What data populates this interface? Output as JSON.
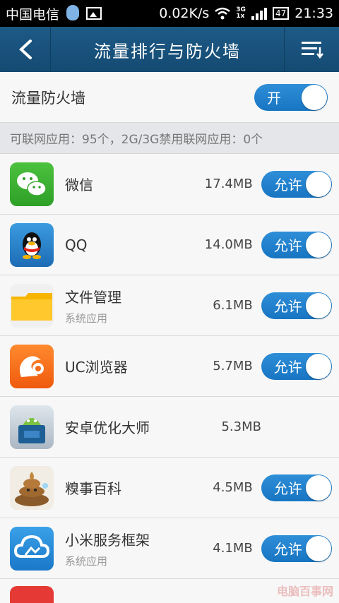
{
  "statusbar": {
    "carrier": "中国电信",
    "speed": "0.02K/s",
    "network": "3G",
    "network_sub": "1x",
    "battery": "47",
    "time": "21:33"
  },
  "header": {
    "title": "流量排行与防火墙"
  },
  "firewall": {
    "label": "流量防火墙",
    "toggle_label": "开"
  },
  "info": {
    "text": "可联网应用：95个，2G/3G禁用联网应用：0个"
  },
  "apps": [
    {
      "name": "微信",
      "sub": "",
      "size": "17.4MB",
      "toggle": "允许",
      "icon": "wechat-icon"
    },
    {
      "name": "QQ",
      "sub": "",
      "size": "14.0MB",
      "toggle": "允许",
      "icon": "qq-icon"
    },
    {
      "name": "文件管理",
      "sub": "系统应用",
      "size": "6.1MB",
      "toggle": "允许",
      "icon": "folder-icon"
    },
    {
      "name": "UC浏览器",
      "sub": "",
      "size": "5.7MB",
      "toggle": "允许",
      "icon": "uc-browser-icon"
    },
    {
      "name": "安卓优化大师",
      "sub": "",
      "size": "5.3MB",
      "toggle": "",
      "icon": "android-optimizer-icon"
    },
    {
      "name": "糗事百科",
      "sub": "",
      "size": "4.5MB",
      "toggle": "允许",
      "icon": "poop-icon"
    },
    {
      "name": "小米服务框架",
      "sub": "系统应用",
      "size": "4.1MB",
      "toggle": "允许",
      "icon": "cloud-icon"
    }
  ],
  "watermark": "电脑百事网"
}
